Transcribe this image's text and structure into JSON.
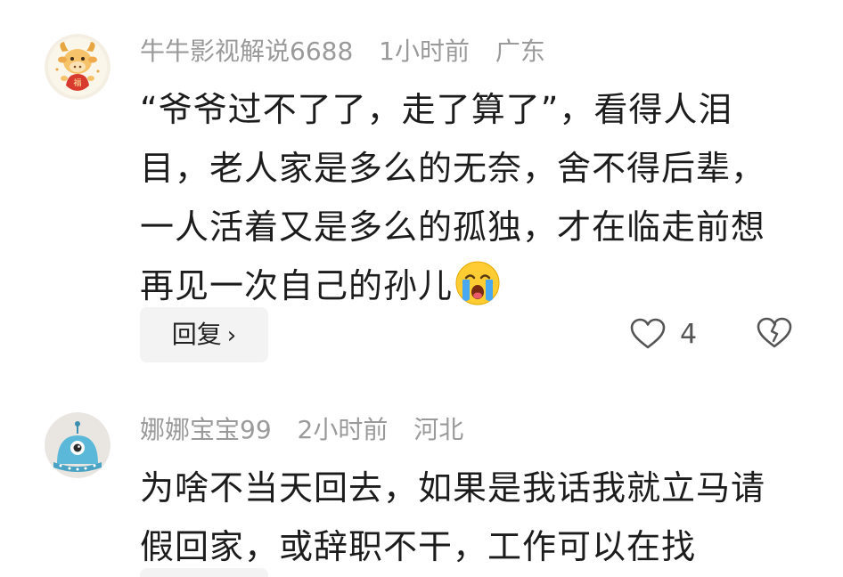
{
  "comments": [
    {
      "username": "牛牛影视解说6688",
      "time": "1小时前",
      "location": "广东",
      "text": "“爷爷过不了了，走了算了”，看得人泪目，老人家是多么的无奈，舍不得后辈，一人活着又是多么的孤独，才在临走前想再见一次自己的孙儿",
      "reply_label": "回复",
      "reply_chevron": "›",
      "like_count": "4",
      "avatar_icon": "cartoon-cow-avatar",
      "emoji_icon": "crying-face-emoji"
    },
    {
      "username": "娜娜宝宝99",
      "time": "2小时前",
      "location": "河北",
      "text": "为啥不当天回去，如果是我话我就立马请假回家，或辞职不干，工作可以在找",
      "avatar_icon": "blue-alien-avatar"
    }
  ],
  "colors": {
    "meta_text": "#9a9a9a",
    "body_text": "#1c1c1c",
    "reply_bg": "#f3f3f3"
  }
}
